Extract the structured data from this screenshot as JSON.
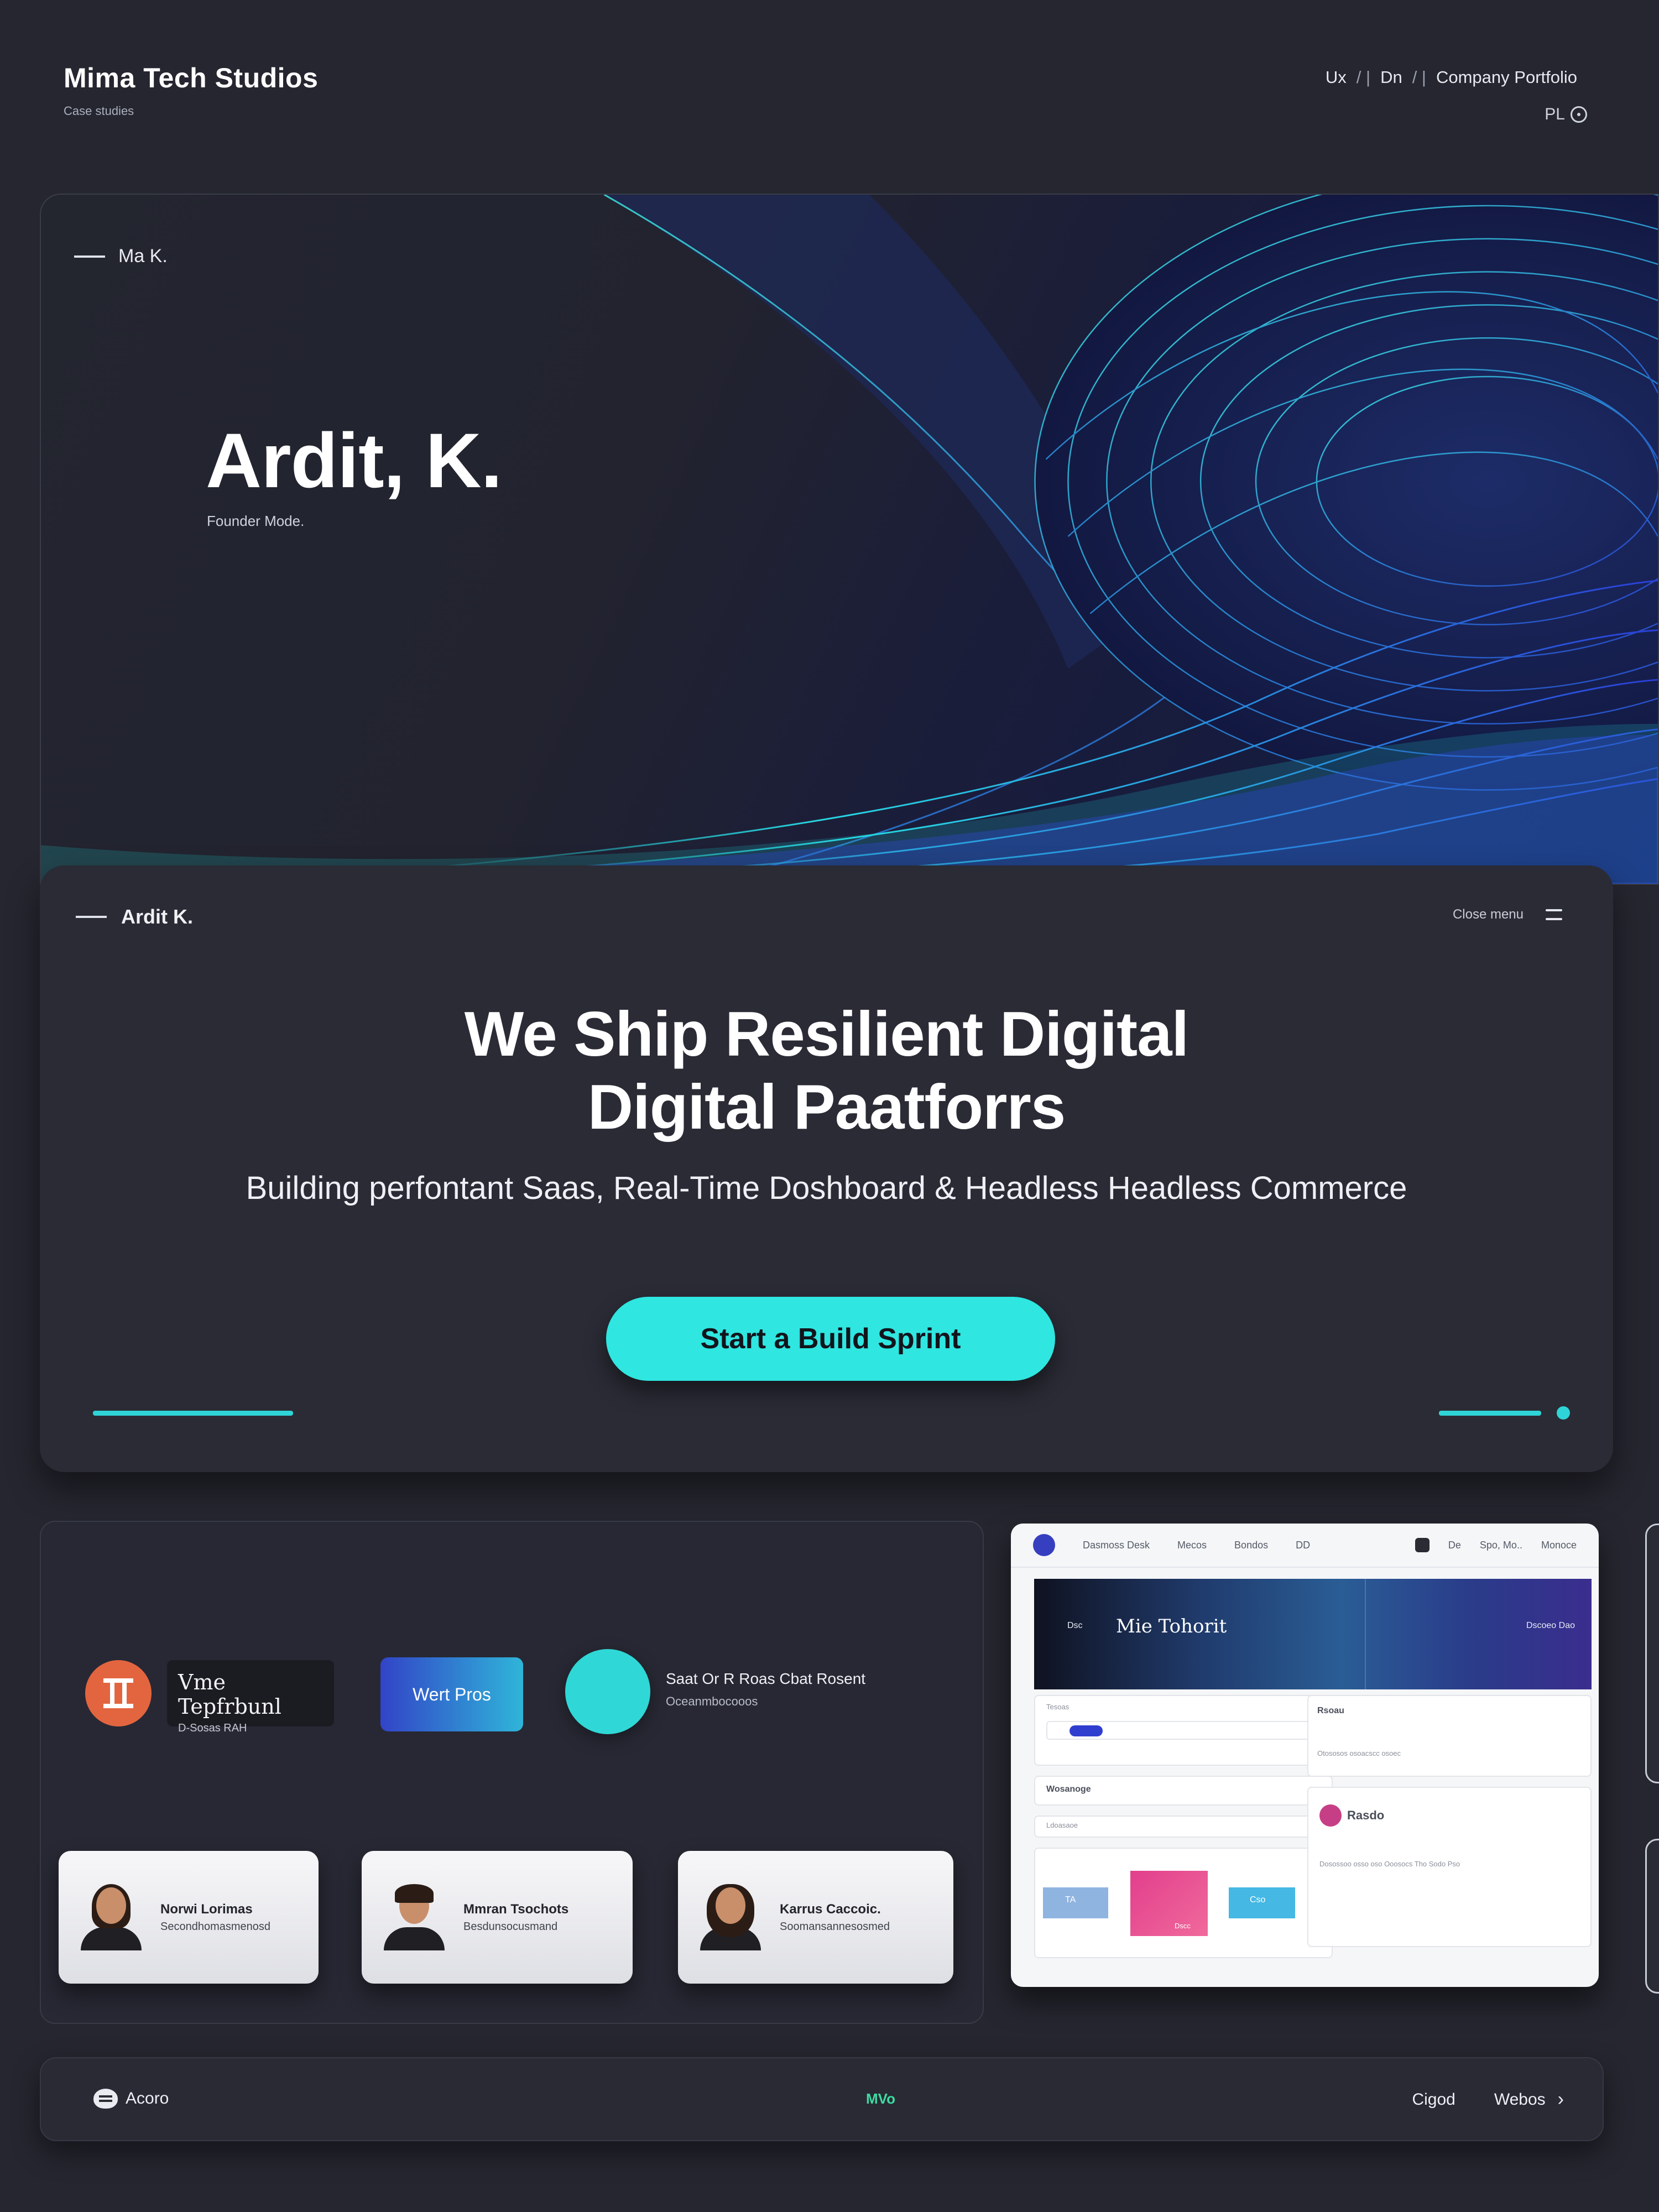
{
  "brand": {
    "name": "Mima Tech Studios",
    "tagline": "Case studies"
  },
  "topnav": {
    "items": [
      "Ux",
      "Dn",
      "Company Portfolio"
    ],
    "separator": "/ |",
    "lang": "PL"
  },
  "hero": {
    "tag": "Ma K.",
    "name": "Ardit, K.",
    "subtitle": "Founder Mode."
  },
  "main_card": {
    "tag": "Ardit K.",
    "menu_label": "Close menu",
    "headline_line1": "We Ship Resilient Digital",
    "headline_line2": "Digital Paatforrs",
    "subline": "Building perfontant Saas, Real-Time Doshboard & Headless Headless Commerce",
    "cta": "Start a Build Sprint"
  },
  "lower": {
    "dark_tile_title": "Vme Tepfrbunl",
    "dark_tile_sub": "D-Sosas RAH",
    "blue_button": "Wert Pros",
    "info_title": "Saat Or R Roas Cbat Rosent",
    "info_sub": "Oceanmbocooos",
    "people": [
      {
        "name": "Norwi Lorimas",
        "role": "Secondhomasmenosd"
      },
      {
        "name": "Mmran Tsochots",
        "role": "Besdunsocusmand"
      },
      {
        "name": "Karrus Caccoic.",
        "role": "Soomansannesosmed"
      }
    ]
  },
  "dashboard": {
    "nav": [
      "Dasmoss Desk",
      "Mecos",
      "Bondos",
      "DD"
    ],
    "nav_right": [
      "De",
      "Spo, Mo..",
      "Monoce"
    ],
    "banner_left": "Dsc",
    "banner_title": "Mie Tohorit",
    "banner_right": "Dscoeo Dao",
    "left_label1": "Tesoas",
    "left_label2": "Wosanoge",
    "left_label3": "Ldoasaoe",
    "right_label1": "Rsoau",
    "right_text1": "Otososos osoacscc osoec",
    "right_label2": "Rasdo",
    "right_text2": "Dosossoo osso oso Ooosocs Tho Sodo Pso",
    "tile_labels": [
      "TA",
      "Dscc",
      "Cso"
    ]
  },
  "footer": {
    "left": "Acoro",
    "mid": "MVo",
    "right1": "Cigod",
    "right2": "Webos"
  },
  "colors": {
    "accent": "#2fe6e0",
    "background": "#25262f",
    "card": "#2a2b35",
    "orange": "#e2653f",
    "blue": "#3244c7"
  },
  "icons": [
    "dash-icon",
    "hamburger-icon",
    "globe-icon",
    "shield-icon",
    "chevron-right-icon"
  ]
}
